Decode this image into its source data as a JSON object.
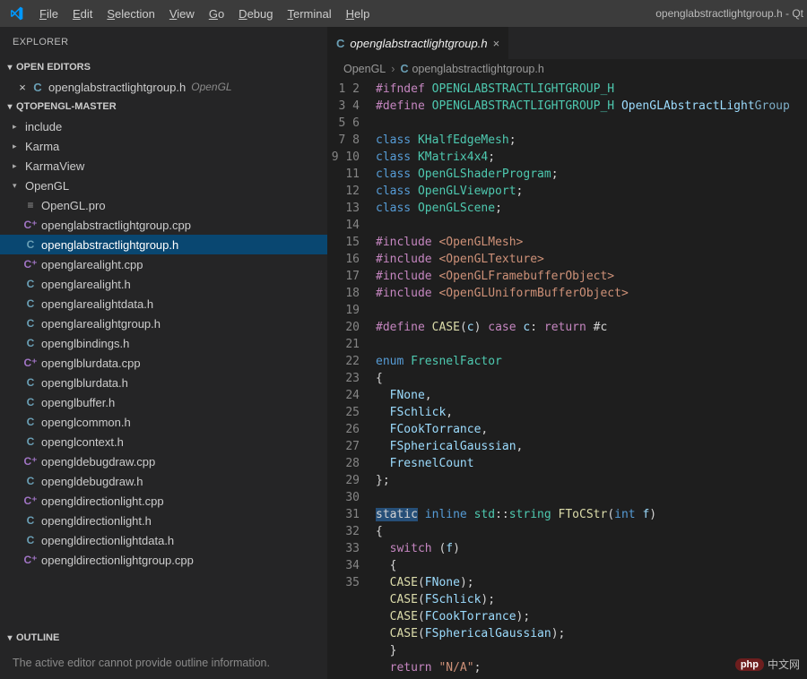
{
  "menubar": {
    "items": [
      "File",
      "Edit",
      "Selection",
      "View",
      "Go",
      "Debug",
      "Terminal",
      "Help"
    ],
    "title": "openglabstractlightgroup.h - Qt"
  },
  "sidebar": {
    "explorer_label": "EXPLORER",
    "open_editors_label": "OPEN EDITORS",
    "open_editor": {
      "icon": "C",
      "name": "openglabstractlightgroup.h",
      "tail": "OpenGL"
    },
    "workspace_label": "QTOPENGL-MASTER",
    "folders": [
      {
        "name": "include",
        "expanded": false
      },
      {
        "name": "Karma",
        "expanded": false
      },
      {
        "name": "KarmaView",
        "expanded": false
      },
      {
        "name": "OpenGL",
        "expanded": true
      }
    ],
    "files": [
      {
        "icon": "≡",
        "cls": "ic-pro",
        "name": "OpenGL.pro"
      },
      {
        "icon": "C⁺",
        "cls": "ic-cpp",
        "name": "openglabstractlightgroup.cpp"
      },
      {
        "icon": "C",
        "cls": "ic-h",
        "name": "openglabstractlightgroup.h",
        "active": true
      },
      {
        "icon": "C⁺",
        "cls": "ic-cpp",
        "name": "openglarealight.cpp"
      },
      {
        "icon": "C",
        "cls": "ic-h",
        "name": "openglarealight.h"
      },
      {
        "icon": "C",
        "cls": "ic-h",
        "name": "openglarealightdata.h"
      },
      {
        "icon": "C",
        "cls": "ic-h",
        "name": "openglarealightgroup.h"
      },
      {
        "icon": "C",
        "cls": "ic-h",
        "name": "openglbindings.h"
      },
      {
        "icon": "C⁺",
        "cls": "ic-cpp",
        "name": "openglblurdata.cpp"
      },
      {
        "icon": "C",
        "cls": "ic-h",
        "name": "openglblurdata.h"
      },
      {
        "icon": "C",
        "cls": "ic-h",
        "name": "openglbuffer.h"
      },
      {
        "icon": "C",
        "cls": "ic-h",
        "name": "openglcommon.h"
      },
      {
        "icon": "C",
        "cls": "ic-h",
        "name": "openglcontext.h"
      },
      {
        "icon": "C⁺",
        "cls": "ic-cpp",
        "name": "opengldebugdraw.cpp"
      },
      {
        "icon": "C",
        "cls": "ic-h",
        "name": "opengldebugdraw.h"
      },
      {
        "icon": "C⁺",
        "cls": "ic-cpp",
        "name": "opengldirectionlight.cpp"
      },
      {
        "icon": "C",
        "cls": "ic-h",
        "name": "opengldirectionlight.h"
      },
      {
        "icon": "C",
        "cls": "ic-h",
        "name": "opengldirectionlightdata.h"
      },
      {
        "icon": "C⁺",
        "cls": "ic-cpp",
        "name": "opengldirectionlightgroup.cpp"
      }
    ],
    "outline_label": "OUTLINE",
    "outline_msg": "The active editor cannot provide outline information."
  },
  "editor": {
    "tab": {
      "icon": "C",
      "name": "openglabstractlightgroup.h"
    },
    "breadcrumb": [
      "OpenGL",
      "openglabstractlightgroup.h"
    ],
    "lines_count": 35
  },
  "watermark": {
    "badge": "php",
    "text": "中文网"
  }
}
